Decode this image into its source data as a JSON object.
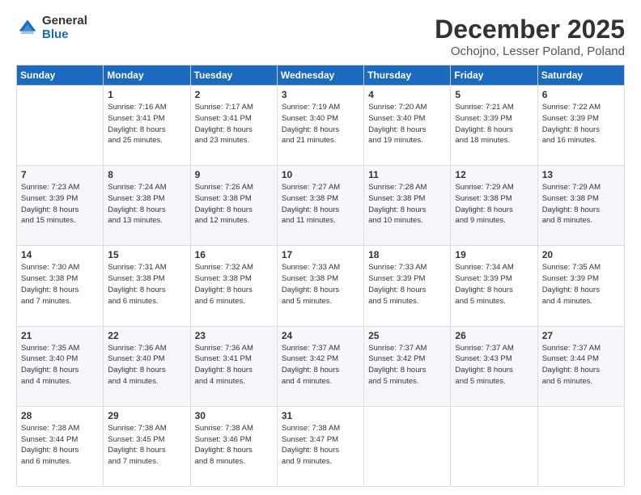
{
  "logo": {
    "general": "General",
    "blue": "Blue"
  },
  "title": {
    "month_year": "December 2025",
    "location": "Ochojno, Lesser Poland, Poland"
  },
  "weekdays": [
    "Sunday",
    "Monday",
    "Tuesday",
    "Wednesday",
    "Thursday",
    "Friday",
    "Saturday"
  ],
  "weeks": [
    [
      {
        "day": "",
        "info": ""
      },
      {
        "day": "1",
        "info": "Sunrise: 7:16 AM\nSunset: 3:41 PM\nDaylight: 8 hours\nand 25 minutes."
      },
      {
        "day": "2",
        "info": "Sunrise: 7:17 AM\nSunset: 3:41 PM\nDaylight: 8 hours\nand 23 minutes."
      },
      {
        "day": "3",
        "info": "Sunrise: 7:19 AM\nSunset: 3:40 PM\nDaylight: 8 hours\nand 21 minutes."
      },
      {
        "day": "4",
        "info": "Sunrise: 7:20 AM\nSunset: 3:40 PM\nDaylight: 8 hours\nand 19 minutes."
      },
      {
        "day": "5",
        "info": "Sunrise: 7:21 AM\nSunset: 3:39 PM\nDaylight: 8 hours\nand 18 minutes."
      },
      {
        "day": "6",
        "info": "Sunrise: 7:22 AM\nSunset: 3:39 PM\nDaylight: 8 hours\nand 16 minutes."
      }
    ],
    [
      {
        "day": "7",
        "info": "Sunrise: 7:23 AM\nSunset: 3:39 PM\nDaylight: 8 hours\nand 15 minutes."
      },
      {
        "day": "8",
        "info": "Sunrise: 7:24 AM\nSunset: 3:38 PM\nDaylight: 8 hours\nand 13 minutes."
      },
      {
        "day": "9",
        "info": "Sunrise: 7:26 AM\nSunset: 3:38 PM\nDaylight: 8 hours\nand 12 minutes."
      },
      {
        "day": "10",
        "info": "Sunrise: 7:27 AM\nSunset: 3:38 PM\nDaylight: 8 hours\nand 11 minutes."
      },
      {
        "day": "11",
        "info": "Sunrise: 7:28 AM\nSunset: 3:38 PM\nDaylight: 8 hours\nand 10 minutes."
      },
      {
        "day": "12",
        "info": "Sunrise: 7:29 AM\nSunset: 3:38 PM\nDaylight: 8 hours\nand 9 minutes."
      },
      {
        "day": "13",
        "info": "Sunrise: 7:29 AM\nSunset: 3:38 PM\nDaylight: 8 hours\nand 8 minutes."
      }
    ],
    [
      {
        "day": "14",
        "info": "Sunrise: 7:30 AM\nSunset: 3:38 PM\nDaylight: 8 hours\nand 7 minutes."
      },
      {
        "day": "15",
        "info": "Sunrise: 7:31 AM\nSunset: 3:38 PM\nDaylight: 8 hours\nand 6 minutes."
      },
      {
        "day": "16",
        "info": "Sunrise: 7:32 AM\nSunset: 3:38 PM\nDaylight: 8 hours\nand 6 minutes."
      },
      {
        "day": "17",
        "info": "Sunrise: 7:33 AM\nSunset: 3:38 PM\nDaylight: 8 hours\nand 5 minutes."
      },
      {
        "day": "18",
        "info": "Sunrise: 7:33 AM\nSunset: 3:39 PM\nDaylight: 8 hours\nand 5 minutes."
      },
      {
        "day": "19",
        "info": "Sunrise: 7:34 AM\nSunset: 3:39 PM\nDaylight: 8 hours\nand 5 minutes."
      },
      {
        "day": "20",
        "info": "Sunrise: 7:35 AM\nSunset: 3:39 PM\nDaylight: 8 hours\nand 4 minutes."
      }
    ],
    [
      {
        "day": "21",
        "info": "Sunrise: 7:35 AM\nSunset: 3:40 PM\nDaylight: 8 hours\nand 4 minutes."
      },
      {
        "day": "22",
        "info": "Sunrise: 7:36 AM\nSunset: 3:40 PM\nDaylight: 8 hours\nand 4 minutes."
      },
      {
        "day": "23",
        "info": "Sunrise: 7:36 AM\nSunset: 3:41 PM\nDaylight: 8 hours\nand 4 minutes."
      },
      {
        "day": "24",
        "info": "Sunrise: 7:37 AM\nSunset: 3:42 PM\nDaylight: 8 hours\nand 4 minutes."
      },
      {
        "day": "25",
        "info": "Sunrise: 7:37 AM\nSunset: 3:42 PM\nDaylight: 8 hours\nand 5 minutes."
      },
      {
        "day": "26",
        "info": "Sunrise: 7:37 AM\nSunset: 3:43 PM\nDaylight: 8 hours\nand 5 minutes."
      },
      {
        "day": "27",
        "info": "Sunrise: 7:37 AM\nSunset: 3:44 PM\nDaylight: 8 hours\nand 6 minutes."
      }
    ],
    [
      {
        "day": "28",
        "info": "Sunrise: 7:38 AM\nSunset: 3:44 PM\nDaylight: 8 hours\nand 6 minutes."
      },
      {
        "day": "29",
        "info": "Sunrise: 7:38 AM\nSunset: 3:45 PM\nDaylight: 8 hours\nand 7 minutes."
      },
      {
        "day": "30",
        "info": "Sunrise: 7:38 AM\nSunset: 3:46 PM\nDaylight: 8 hours\nand 8 minutes."
      },
      {
        "day": "31",
        "info": "Sunrise: 7:38 AM\nSunset: 3:47 PM\nDaylight: 8 hours\nand 9 minutes."
      },
      {
        "day": "",
        "info": ""
      },
      {
        "day": "",
        "info": ""
      },
      {
        "day": "",
        "info": ""
      }
    ]
  ]
}
